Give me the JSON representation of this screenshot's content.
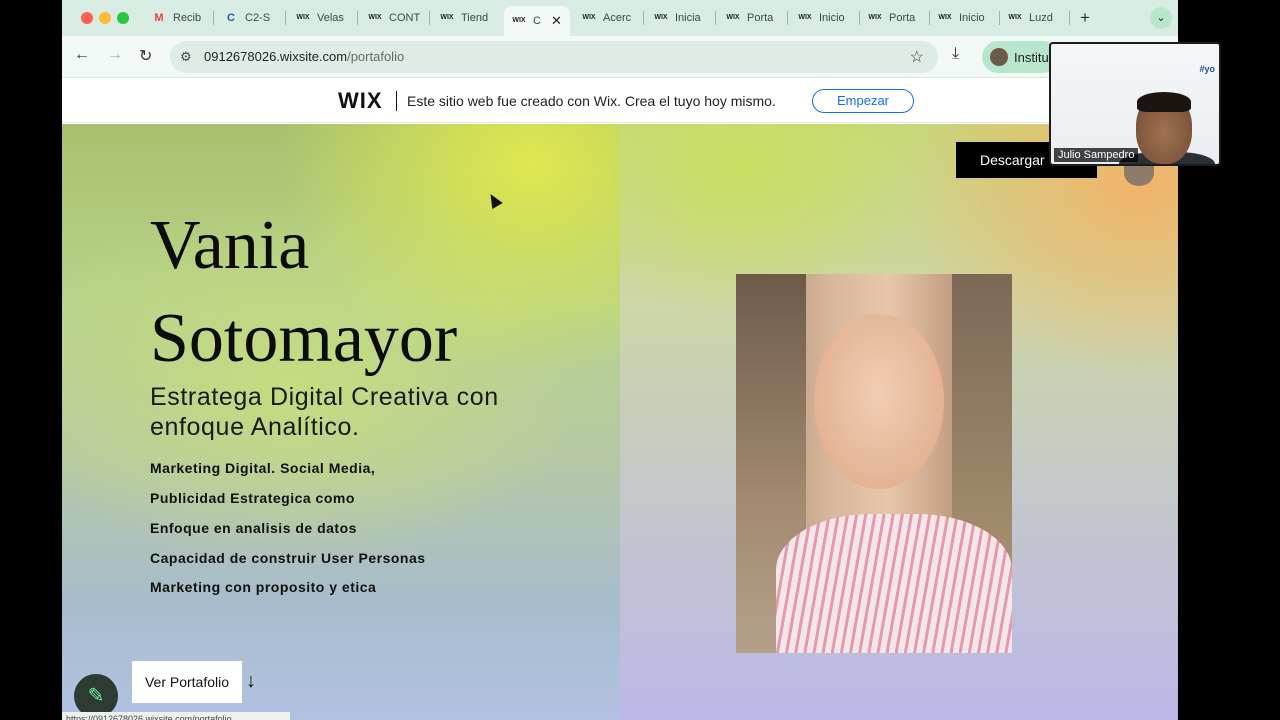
{
  "browser": {
    "tabs": [
      {
        "label": "Recib",
        "icon": "M"
      },
      {
        "label": "C2-S",
        "icon": "C"
      },
      {
        "label": "Velas",
        "icon": "WIX"
      },
      {
        "label": "CONT",
        "icon": "WIX"
      },
      {
        "label": "Tiend",
        "icon": "WIX"
      },
      {
        "label": "C",
        "icon": "WIX",
        "active": true
      },
      {
        "label": "Acerc",
        "icon": "WIX"
      },
      {
        "label": "Inicia",
        "icon": "WIX"
      },
      {
        "label": "Porta",
        "icon": "WIX"
      },
      {
        "label": "Inicio",
        "icon": "WIX"
      },
      {
        "label": "Porta",
        "icon": "WIX"
      },
      {
        "label": "Inicio",
        "icon": "WIX"
      },
      {
        "label": "Luzd",
        "icon": "WIX"
      }
    ],
    "address": {
      "host": "0912678026.wixsite.com",
      "path": "/portafolio"
    },
    "profile_label": "Institu",
    "status_url": "https://0912678026.wixsite.com/portafolio",
    "accent": "#b8e6cc"
  },
  "wix_banner": {
    "logo": "WIX",
    "text": "Este sitio web fue creado con Wix. Crea el tuyo hoy mismo.",
    "cta": "Empezar"
  },
  "hero": {
    "first_name": "Vania",
    "last_name": "Sotomayor",
    "subtitle": "Estratega Digital Creativa con enfoque Analítico.",
    "skills": [
      "Marketing Digital. Social Media,",
      "Publicidad Estrategica como",
      "Enfoque en analisis de datos",
      "Capacidad de construir User Personas",
      "Marketing con proposito y etica"
    ],
    "portfolio_button": "Ver Portafolio",
    "download_button": "Descargar"
  },
  "video_call": {
    "participant": "Julio Sampedro",
    "background_text": "#yo"
  }
}
